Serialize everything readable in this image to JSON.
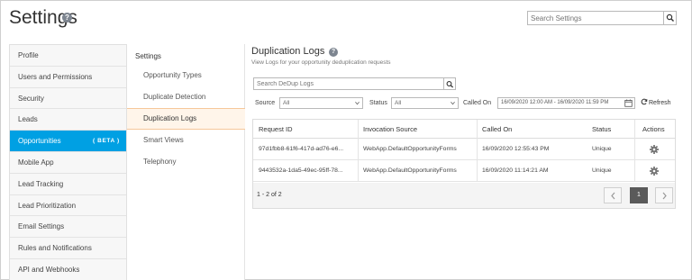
{
  "header": {
    "title": "Settings",
    "search_placeholder": "Search Settings"
  },
  "leftnav": {
    "items": [
      {
        "label": "Profile"
      },
      {
        "label": "Users and Permissions"
      },
      {
        "label": "Security"
      },
      {
        "label": "Leads"
      },
      {
        "label": "Opportunities",
        "badge": "( BETA )",
        "active": true
      },
      {
        "label": "Mobile App"
      },
      {
        "label": "Lead Tracking"
      },
      {
        "label": "Lead Prioritization"
      },
      {
        "label": "Email Settings"
      },
      {
        "label": "Rules and Notifications"
      },
      {
        "label": "API and Webhooks"
      }
    ]
  },
  "subnav": {
    "heading": "Settings",
    "items": [
      {
        "label": "Opportunity Types"
      },
      {
        "label": "Duplicate Detection"
      },
      {
        "label": "Duplication Logs",
        "active": true
      },
      {
        "label": "Smart Views"
      },
      {
        "label": "Telephony"
      }
    ]
  },
  "main": {
    "title": "Duplication Logs",
    "subtitle": "View Logs for your opportunity deduplication requests",
    "search_placeholder": "Search DeDup Logs",
    "filters": {
      "source_label": "Source",
      "source_value": "All",
      "status_label": "Status",
      "status_value": "All",
      "called_on_label": "Called On",
      "called_on_value": "16/09/2020 12:00 AM - 16/09/2020 11:59 PM",
      "refresh_label": "Refresh"
    },
    "table": {
      "columns": [
        "Request ID",
        "Invocation Source",
        "Called On",
        "Status",
        "Actions"
      ],
      "rows": [
        {
          "request_id": "97d1fbb8-61f6-417d-ad76-e6...",
          "source": "WebApp.DefaultOpportunityForms",
          "called_on": "16/09/2020 12:55:43 PM",
          "status": "Unique"
        },
        {
          "request_id": "9443532a-1da5-49ec-95ff-78...",
          "source": "WebApp.DefaultOpportunityForms",
          "called_on": "16/09/2020 11:14:21 AM",
          "status": "Unique"
        }
      ]
    },
    "pagination": {
      "info": "1 - 2 of 2",
      "current_page": "1"
    }
  },
  "colors": {
    "accent": "#00a0e3",
    "active_sub_bg": "#fff5ea",
    "active_sub_border": "#f6c79a",
    "current_page_bg": "#5a5a5a"
  }
}
